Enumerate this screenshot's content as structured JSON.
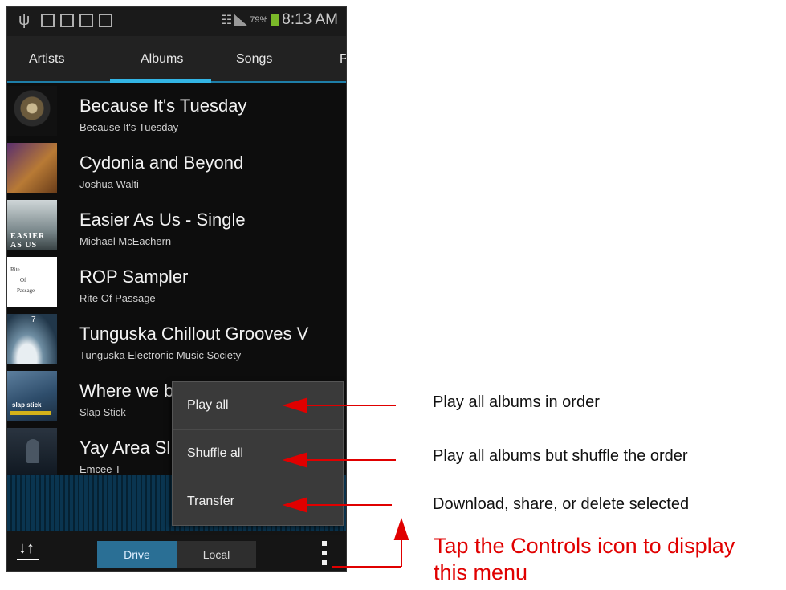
{
  "status_bar": {
    "battery": "79%",
    "time": "8:13 AM"
  },
  "tabs": [
    {
      "label": "Artists"
    },
    {
      "label": "Albums"
    },
    {
      "label": "Songs"
    },
    {
      "label": "P"
    }
  ],
  "albums": [
    {
      "title": "Because It's Tuesday",
      "artist": "Because It's Tuesday"
    },
    {
      "title": "Cydonia and Beyond",
      "artist": "Joshua Walti"
    },
    {
      "title": "Easier As Us - Single",
      "artist": "Michael McEachern"
    },
    {
      "title": "ROP Sampler",
      "artist": "Rite Of Passage"
    },
    {
      "title": "Tunguska Chillout Grooves V",
      "artist": "Tunguska Electronic Music Society"
    },
    {
      "title": "Where we b",
      "artist": "Slap Stick"
    },
    {
      "title": "Yay Area Sl",
      "artist": "Emcee T"
    }
  ],
  "album_art": {
    "easier_as_us": "EASIER AS US",
    "rop": [
      "Rite",
      "Of",
      "Passage"
    ],
    "tunguska": "7",
    "slap_stick": "slap stick"
  },
  "bottom_bar": {
    "drive": "Drive",
    "local": "Local"
  },
  "menu": [
    {
      "label": "Play all"
    },
    {
      "label": "Shuffle all"
    },
    {
      "label": "Transfer"
    }
  ],
  "annotations": {
    "play_all": "Play all albums in order",
    "shuffle_all": "Play all albums but shuffle the order",
    "transfer": "Download, share, or delete selected",
    "controls_line1": "Tap the Controls icon to display",
    "controls_line2": "this menu"
  },
  "colors": {
    "accent": "#33b5e5",
    "annotation_red": "#e00000",
    "drive_selected": "#2a6f95"
  },
  "icons": [
    "usb-icon",
    "sim-icon",
    "gallery-icon",
    "gmail-icon",
    "store-icon",
    "wifi-icon",
    "signal-icon",
    "battery-icon",
    "queue-icon",
    "overflow-menu-icon"
  ]
}
